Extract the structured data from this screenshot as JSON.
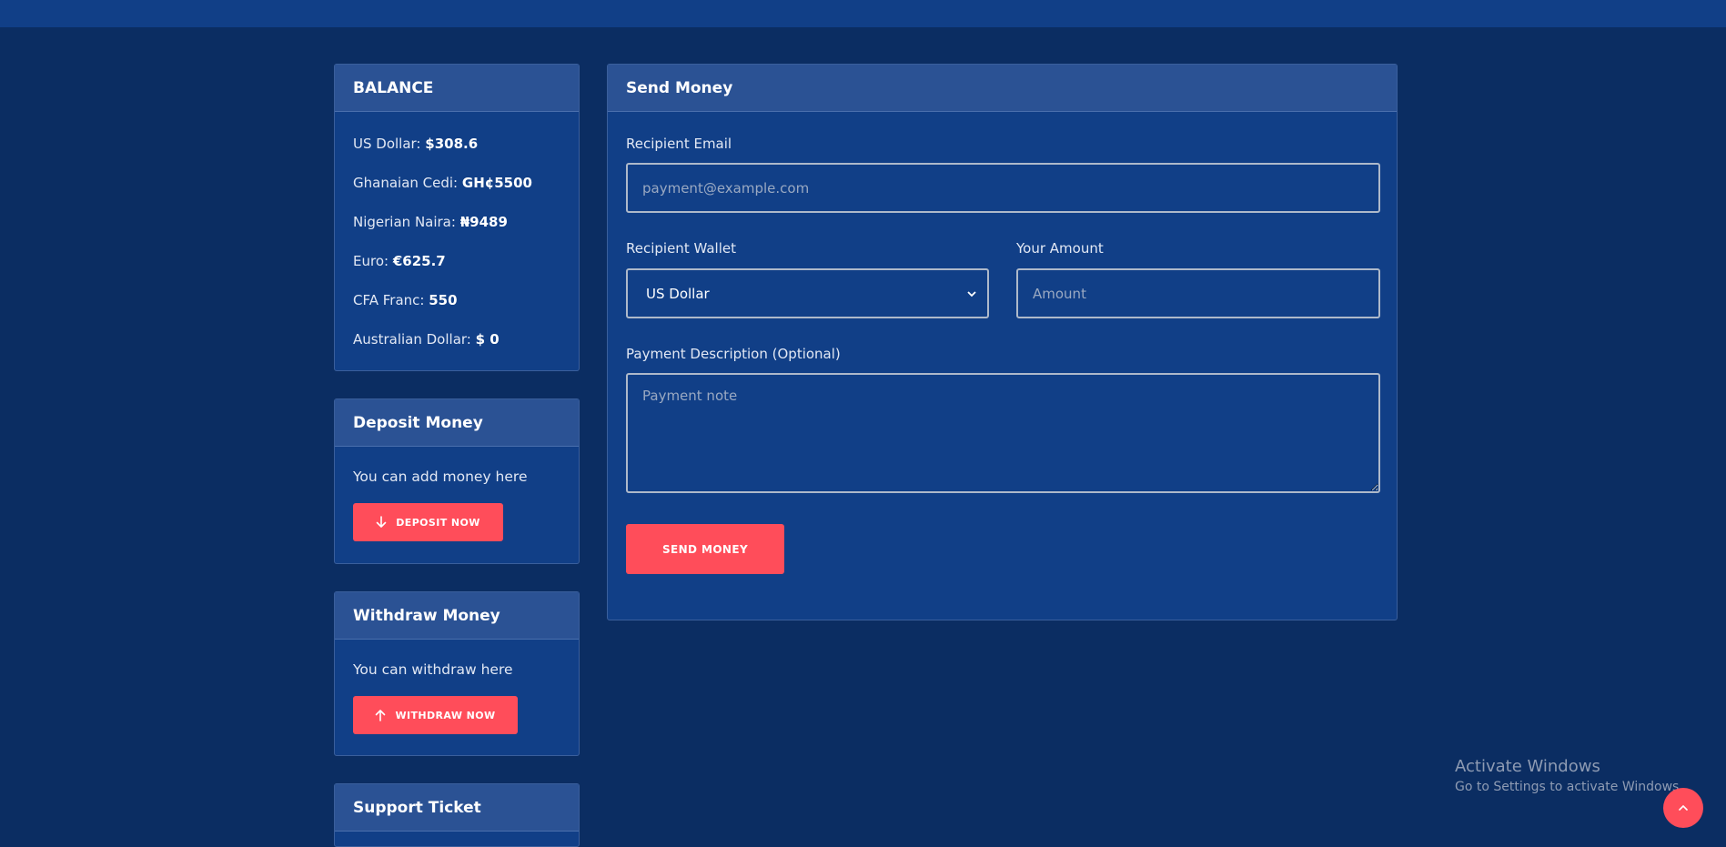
{
  "balance": {
    "title": "BALANCE",
    "items": [
      {
        "label": "US Dollar:",
        "value": "$308.6"
      },
      {
        "label": "Ghanaian Cedi:",
        "value": "GH¢5500"
      },
      {
        "label": "Nigerian Naira:",
        "value": "₦9489"
      },
      {
        "label": "Euro:",
        "value": "€625.7"
      },
      {
        "label": "CFA Franc:",
        "value": "550"
      },
      {
        "label": "Australian Dollar:",
        "value": "$ 0"
      }
    ]
  },
  "deposit": {
    "title": "Deposit Money",
    "text": "You can add money here",
    "button": "DEPOSIT NOW",
    "icon": "arrow-down-icon"
  },
  "withdraw": {
    "title": "Withdraw Money",
    "text": "You can withdraw here",
    "button": "WITHDRAW NOW",
    "icon": "arrow-up-icon"
  },
  "support": {
    "title": "Support Ticket"
  },
  "send_money": {
    "title": "Send Money",
    "recipient_email": {
      "label": "Recipient Email",
      "placeholder": "payment@example.com",
      "value": ""
    },
    "recipient_wallet": {
      "label": "Recipient Wallet",
      "selected": "US Dollar"
    },
    "amount": {
      "label": "Your Amount",
      "placeholder": "Amount",
      "value": ""
    },
    "description": {
      "label": "Payment Description (Optional)",
      "placeholder": "Payment note",
      "value": ""
    },
    "submit": "SEND MONEY"
  },
  "windows_watermark": {
    "title": "Activate Windows",
    "subtitle": "Go to Settings to activate Windows."
  },
  "colors": {
    "background": "#0b2d62",
    "card": "#113f87",
    "card_header": "#2b5294",
    "accent": "#ff4d5a"
  }
}
